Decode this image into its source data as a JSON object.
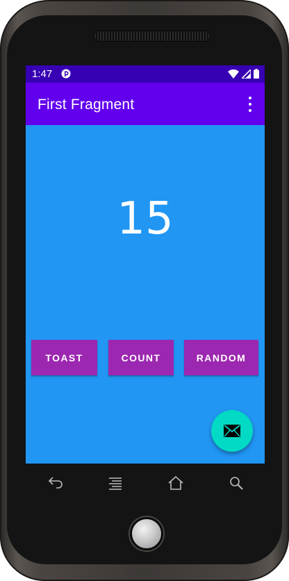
{
  "status_bar": {
    "time": "1:47",
    "icons": [
      "app-notification-icon",
      "wifi-icon",
      "signal-icon",
      "battery-icon"
    ]
  },
  "app_bar": {
    "title": "First Fragment",
    "overflow_icon": "more-vert-icon"
  },
  "main": {
    "count_value": "15"
  },
  "buttons": {
    "toast_label": "TOAST",
    "count_label": "COUNT",
    "random_label": "RANDOM"
  },
  "fab": {
    "icon": "email-icon"
  },
  "nav_keys": [
    "back-icon",
    "menu-icon",
    "home-icon",
    "search-icon"
  ],
  "colors": {
    "status_bar": "#3700b3",
    "app_bar": "#6200ee",
    "background": "#2196f3",
    "button": "#9c27b0",
    "fab": "#03dac5"
  }
}
